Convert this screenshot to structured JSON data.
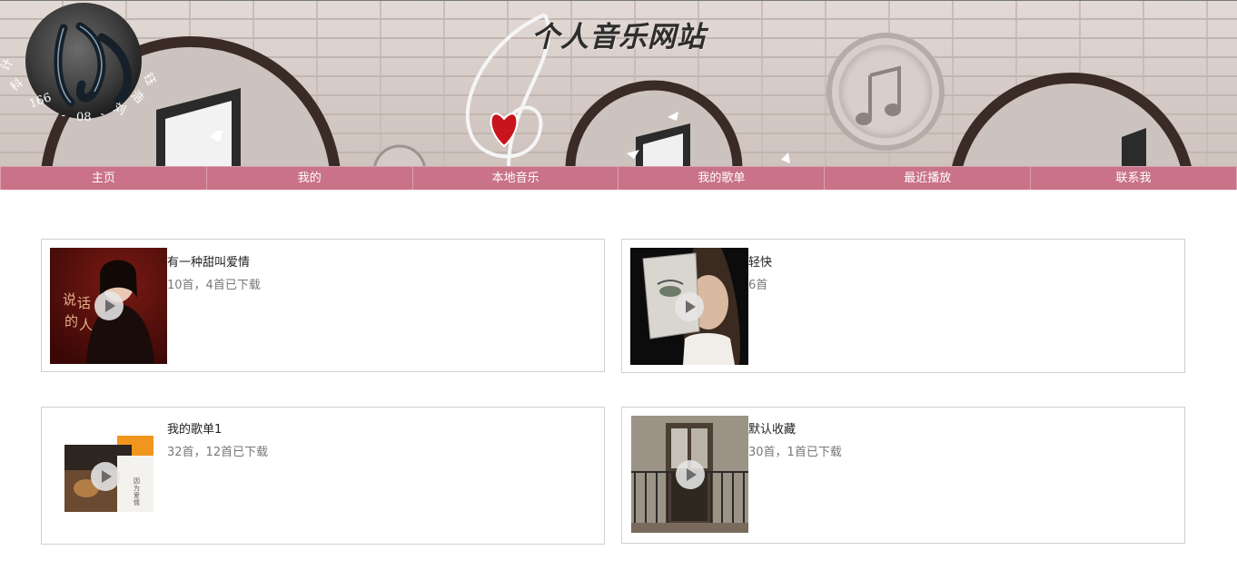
{
  "header": {
    "site_title": "个人音乐网站"
  },
  "nav": {
    "items": [
      "主页",
      "我的",
      "本地音乐",
      "我的歌单",
      "最近播放",
      "联系我"
    ],
    "color": "#c97288"
  },
  "playlists": [
    {
      "name": "有一种甜叫爱情",
      "meta": "10首，4首已下载"
    },
    {
      "name": "轻快",
      "meta": "6首"
    },
    {
      "name": "我的歌单1",
      "meta": "32首，12首已下载"
    },
    {
      "name": "默认收藏",
      "meta": "30首，1首已下载"
    }
  ],
  "icons": {
    "play": "play-icon",
    "logo": "avatar-logo"
  }
}
